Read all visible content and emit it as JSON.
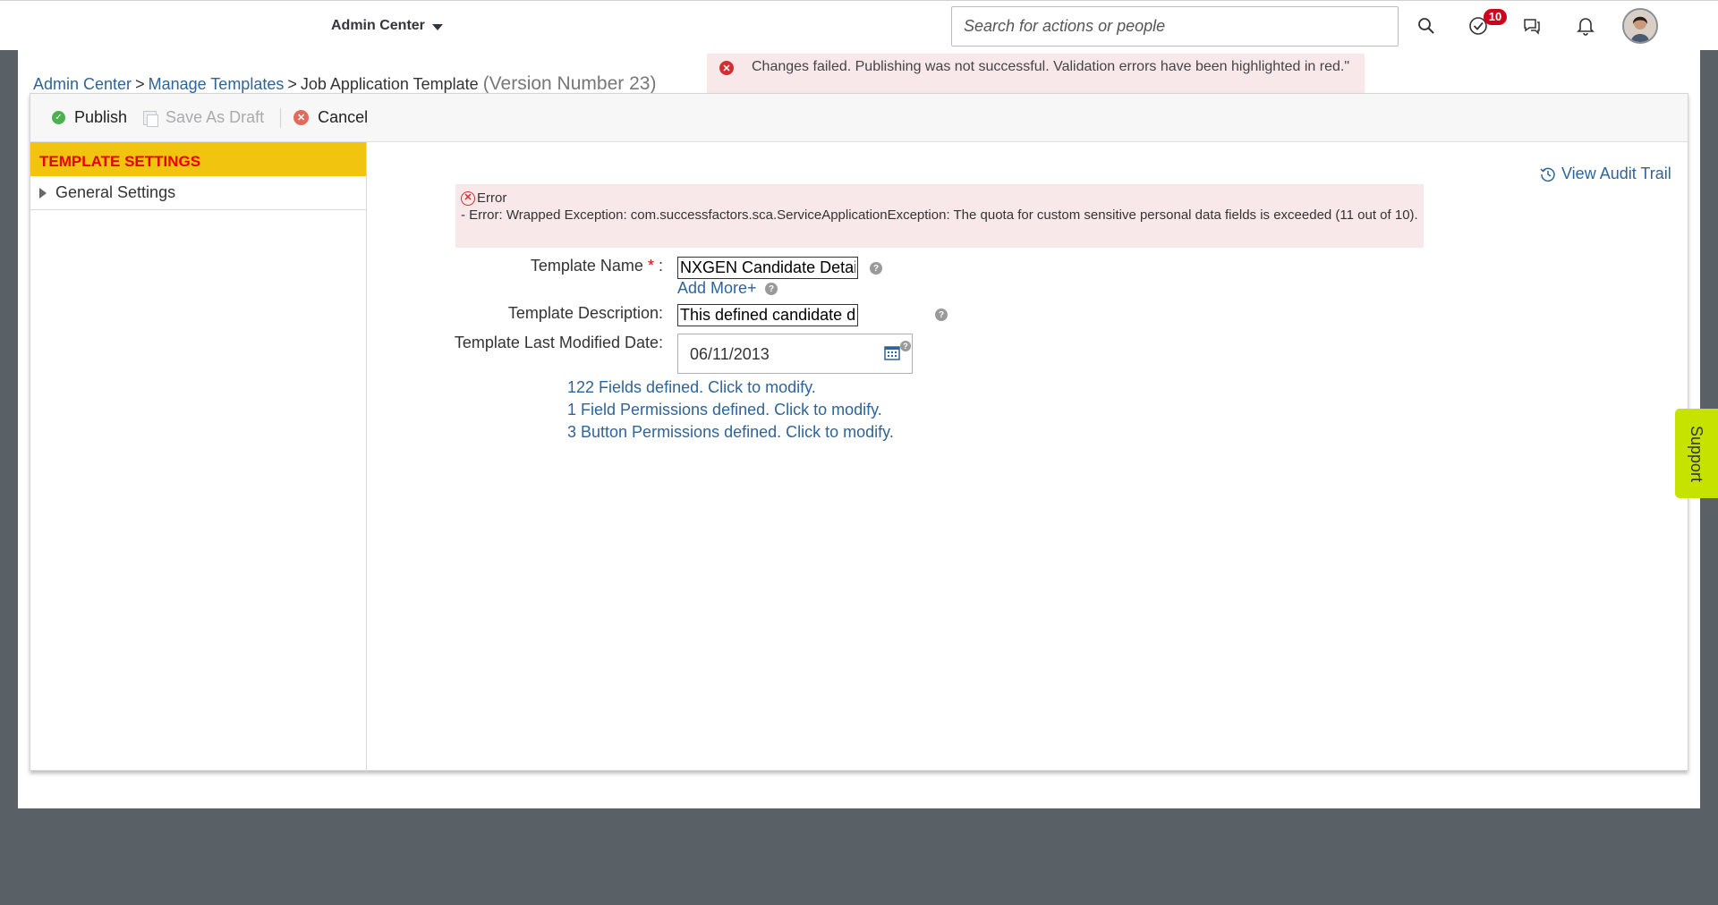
{
  "shell": {
    "app_menu_label": "Admin Center",
    "search_placeholder": "Search for actions or people",
    "todo_badge_count": "10"
  },
  "breadcrumb": {
    "items": [
      "Admin Center",
      "Manage Templates"
    ],
    "current": "Job Application Template",
    "version": "(Version Number 23)"
  },
  "toast": {
    "message": "Changes failed. Publishing was not successful. Validation errors have been highlighted in red.\""
  },
  "toolbar": {
    "publish_label": "Publish",
    "save_draft_label": "Save As Draft",
    "cancel_label": "Cancel"
  },
  "sidebar": {
    "header": "TEMPLATE SETTINGS",
    "items": [
      {
        "label": "General Settings"
      }
    ]
  },
  "audit_trail_label": "View Audit Trail",
  "error": {
    "title": "Error",
    "message": "- Error: Wrapped Exception: com.successfactors.sca.ServiceApplicationException: The quota for custom sensitive personal data fields is exceeded (11 out of 10)."
  },
  "form": {
    "template_name_label": "Template Name",
    "required_marker": "*",
    "label_colon": ":",
    "template_name_value": "NXGEN Candidate Detail Page",
    "add_more_label": "Add More+",
    "template_description_label": "Template Description:",
    "template_description_value": "This defined candidate detail page template",
    "last_modified_label": "Template Last Modified Date:",
    "last_modified_value": "06/11/2013"
  },
  "links": {
    "fields": "122 Fields defined. Click to modify.",
    "field_permissions": "1 Field Permissions defined. Click to modify.",
    "button_permissions": "3 Button Permissions defined. Click to modify."
  },
  "support_label": "Support",
  "colors": {
    "accent_link": "#2f6497",
    "sidebar_header_bg": "#f1c40f",
    "sidebar_header_text": "#e60000",
    "error_bg": "#f9e8ea",
    "support_tab": "#c6e300"
  }
}
